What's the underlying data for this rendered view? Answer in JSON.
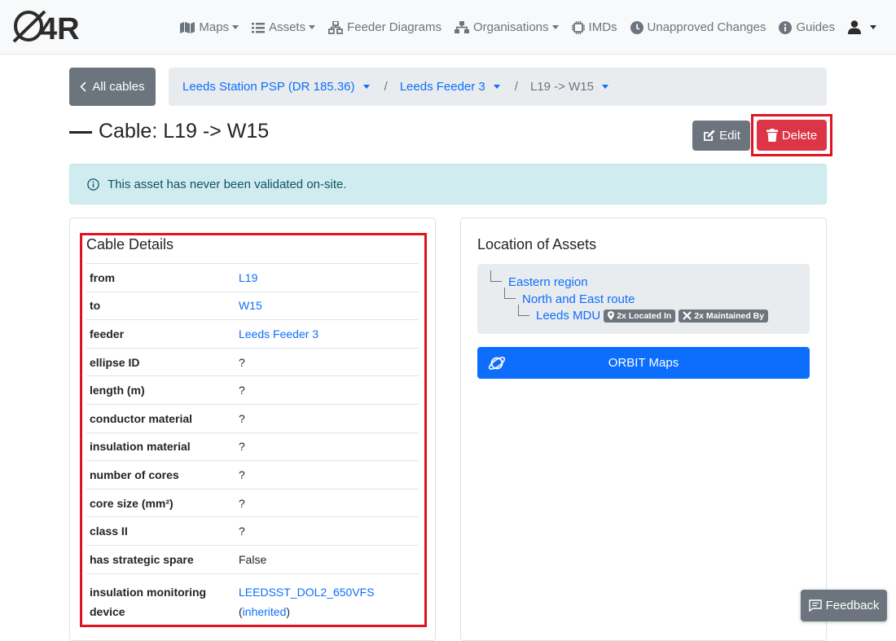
{
  "brand": {
    "logo_text": "O4R"
  },
  "nav": {
    "maps": "Maps",
    "assets": "Assets",
    "feeder_diagrams": "Feeder Diagrams",
    "organisations": "Organisations",
    "imds": "IMDs",
    "unapproved_changes": "Unapproved Changes",
    "guides": "Guides"
  },
  "back_button": "All cables",
  "breadcrumb": {
    "items": [
      {
        "label": "Leeds Station PSP (DR 185.36)"
      },
      {
        "label": "Leeds Feeder 3"
      },
      {
        "label": "L19 -> W15"
      }
    ]
  },
  "page": {
    "title": "Cable: L19 -> W15"
  },
  "actions": {
    "edit": "Edit",
    "delete": "Delete"
  },
  "alert": {
    "text": "This asset has never been validated on-site."
  },
  "details": {
    "title": "Cable Details",
    "rows": [
      {
        "key": "from",
        "value": "L19"
      },
      {
        "key": "to",
        "value": "W15"
      },
      {
        "key": "feeder",
        "value": "Leeds Feeder 3"
      },
      {
        "key": "ellipse ID",
        "value": "?"
      },
      {
        "key": "length (m)",
        "value": "?"
      },
      {
        "key": "conductor material",
        "value": "?"
      },
      {
        "key": "insulation material",
        "value": "?"
      },
      {
        "key": "number of cores",
        "value": "?"
      },
      {
        "key": "core size (mm²)",
        "value": "?"
      },
      {
        "key": "class II",
        "value": "?"
      },
      {
        "key": "has strategic spare",
        "value": "False"
      },
      {
        "key": "insulation monitoring device",
        "value": "LEEDSST_DOL2_650VFS",
        "paren_open": "(",
        "sub_value": "inherited",
        "paren_close": ")"
      }
    ]
  },
  "location": {
    "title": "Location of Assets",
    "tree": {
      "region": "Eastern region",
      "route": "North and East route",
      "mdu": "Leeds MDU",
      "badge_located": "2x Located In",
      "badge_maintained": "2x Maintained By"
    },
    "orbit_button": "ORBIT Maps"
  },
  "feedback": "Feedback",
  "colors": {
    "primary": "#0d6efd",
    "secondary": "#6c757d",
    "danger": "#dc3545",
    "highlight": "#e0141f",
    "info_bg": "#d1ecf1"
  }
}
